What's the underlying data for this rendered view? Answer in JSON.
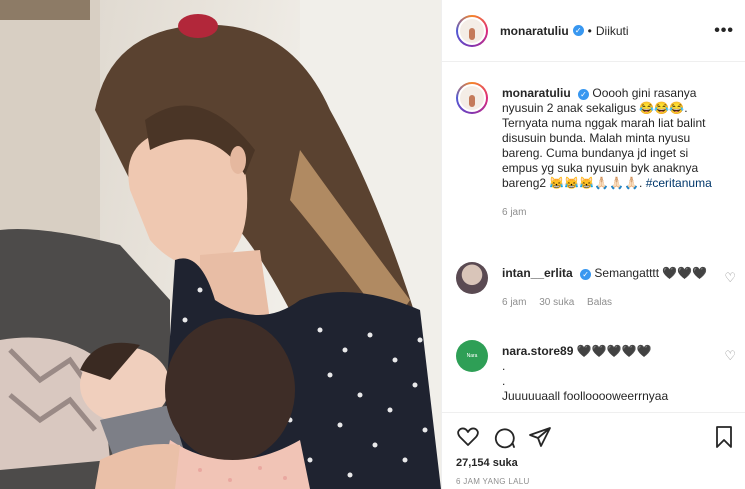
{
  "post": {
    "username": "monaratuliu",
    "follow_status": "Diikuti",
    "more": "•••"
  },
  "caption": {
    "username": "monaratuliu",
    "text": "Ooooh gini rasanya nyusuin 2 anak sekaligus 😂😂😂. Ternyata numa nggak marah liat balint disusuin bunda. Malah minta nyusu bareng. Cuma bundanya jd inget si empus yg suka nyusuin byk anaknya bareng2 😹😹😹🙏🏻🙏🏻🙏🏻.",
    "hashtag": "#ceritanuma",
    "time": "6 jam"
  },
  "comments": [
    {
      "username": "intan__erlita",
      "text": "Semangatttt 🖤🖤🖤",
      "time": "6 jam",
      "likes": "30 suka",
      "reply": "Balas"
    },
    {
      "username": "nara.store89",
      "text": "🖤🖤🖤🖤🖤",
      "lines": [
        ".",
        "."
      ],
      "extra": "Juuuuuaall foollooooweerrnyaa"
    }
  ],
  "engagement": {
    "likes": "27,154 suka",
    "posted": "6 JAM YANG LALU"
  },
  "colors": {
    "verified": "#3897f0",
    "hashtag": "#00376b",
    "muted": "#8e8e8e"
  },
  "icons": [
    "heart-icon",
    "comment-icon",
    "share-icon",
    "bookmark-icon",
    "more-icon",
    "verified-icon"
  ]
}
